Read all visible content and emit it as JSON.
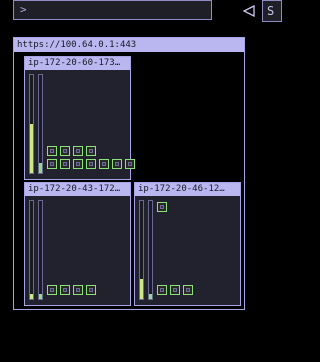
{
  "toolbar": {
    "command_value": ">",
    "back_icon": "back-triangle-icon",
    "clip_label": "S"
  },
  "cluster": {
    "url": "https://100.64.0.1:443"
  },
  "nodes": [
    {
      "name": "ip-172-20-60-173…",
      "cpu_fraction": 0.5,
      "mem_fraction": 0.1,
      "pod_count": 11
    },
    {
      "name": "ip-172-20-43-172…",
      "cpu_fraction": 0.05,
      "mem_fraction": 0.05,
      "pod_count": 4
    },
    {
      "name": "ip-172-20-46-12…",
      "cpu_fraction": 0.2,
      "mem_fraction": 0.05,
      "pod_count": 4
    }
  ],
  "colors": {
    "accent": "#b9b6f0",
    "cpu_gauge": "#cde68a",
    "mem_gauge": "#8ee07e",
    "pod_border": "#8ee07e"
  }
}
